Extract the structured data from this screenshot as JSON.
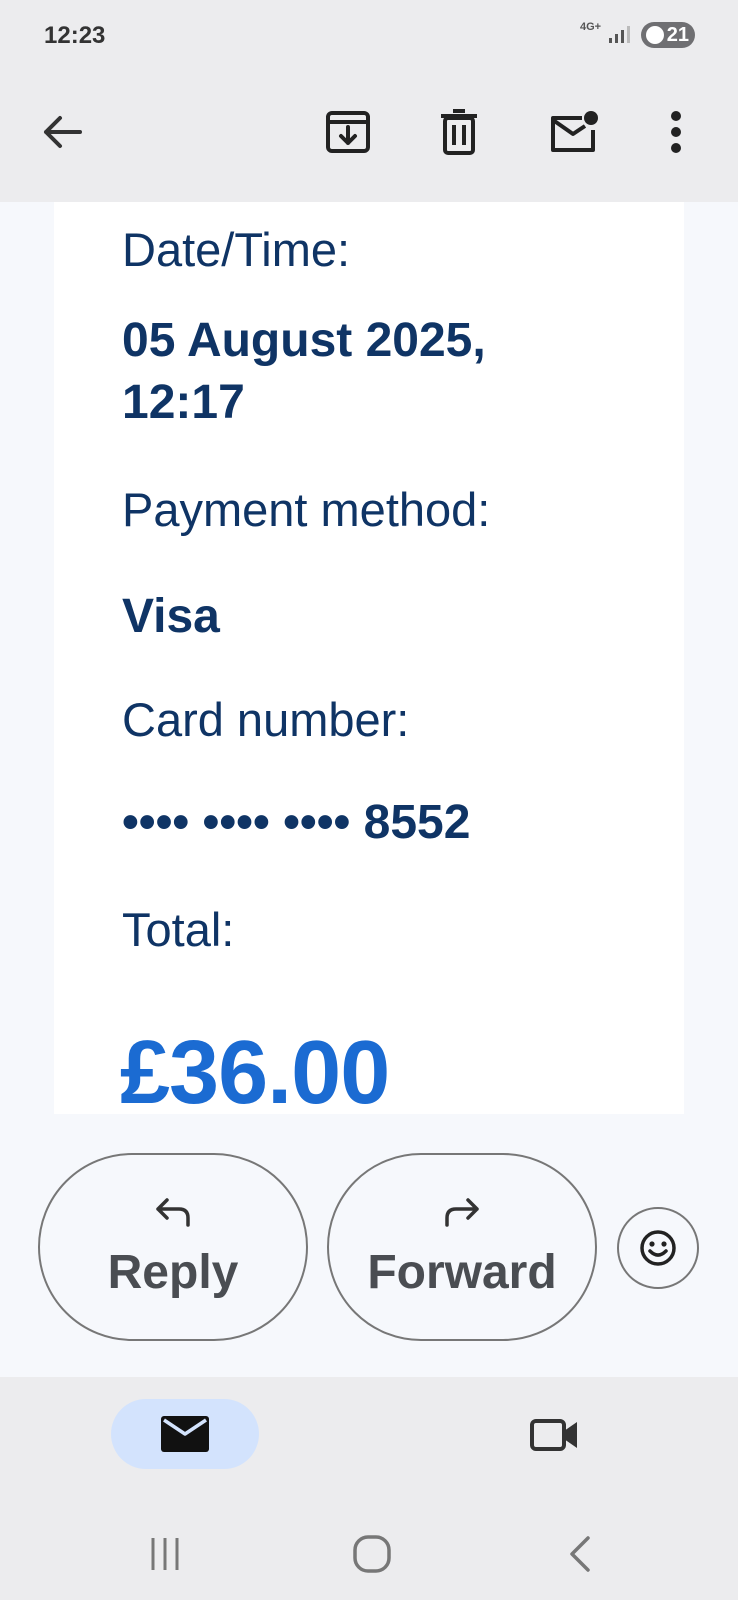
{
  "status_bar": {
    "time": "12:23",
    "network": "4G+",
    "battery": "21"
  },
  "toolbar": {
    "icons": [
      "arrow-left-icon",
      "archive-icon",
      "trash-icon",
      "mark-unread-icon",
      "more-vert-icon"
    ]
  },
  "email": {
    "datetime_label": "Date/Time:",
    "datetime_value": "05 August 2025, 12:17",
    "payment_label": "Payment method:",
    "payment_value": "Visa",
    "card_label": "Card number:",
    "card_value": "•••• •••• •••• 8552",
    "total_label": "Total:",
    "total_value": "£36.00"
  },
  "actions": {
    "reply_label": "Reply",
    "forward_label": "Forward"
  },
  "colors": {
    "text_navy": "#0f3465",
    "total_blue": "#1b6bd2",
    "nav_active": "#d3e3fd"
  }
}
